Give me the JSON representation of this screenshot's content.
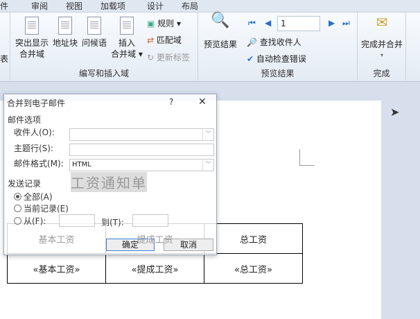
{
  "tabs": [
    "件",
    "审阅",
    "视图",
    "加载项",
    "设计",
    "布局"
  ],
  "ribbon": {
    "left_partial": "表",
    "group_write": {
      "label": "编写和插入域",
      "highlight": [
        "突出显示",
        "合并域"
      ],
      "address": "地址块",
      "greeting": "问候语",
      "insert": [
        "插入",
        "合并域 ▾"
      ],
      "rules": "规则 ▾",
      "match": "匹配域",
      "update": "更新标签"
    },
    "group_preview": {
      "label": "预览结果",
      "preview": "预览结果",
      "record": "1",
      "find": "查找收件人",
      "check": "自动检查错误"
    },
    "group_finish": {
      "label": "完成",
      "finish": "完成并合并",
      "arrow": "▾"
    }
  },
  "document": {
    "title": "工资通知单",
    "headers": [
      "基本工资",
      "提成工资",
      "总工资"
    ],
    "fields": [
      "«基本工资»",
      "«提成工资»",
      "«总工资»"
    ]
  },
  "dialog": {
    "title": "合并到电子邮件",
    "help": "?",
    "close": "✕",
    "section1": "邮件选项",
    "to_label": "收件人(O):",
    "to_value": "",
    "subject_label": "主题行(S):",
    "subject_value": "",
    "format_label": "邮件格式(M):",
    "format_value": "HTML",
    "section2": "发送记录",
    "all": "全部(A)",
    "current": "当前记录(E)",
    "from": "从(F):",
    "to": "到(T):",
    "ok": "确定",
    "cancel": "取消"
  }
}
